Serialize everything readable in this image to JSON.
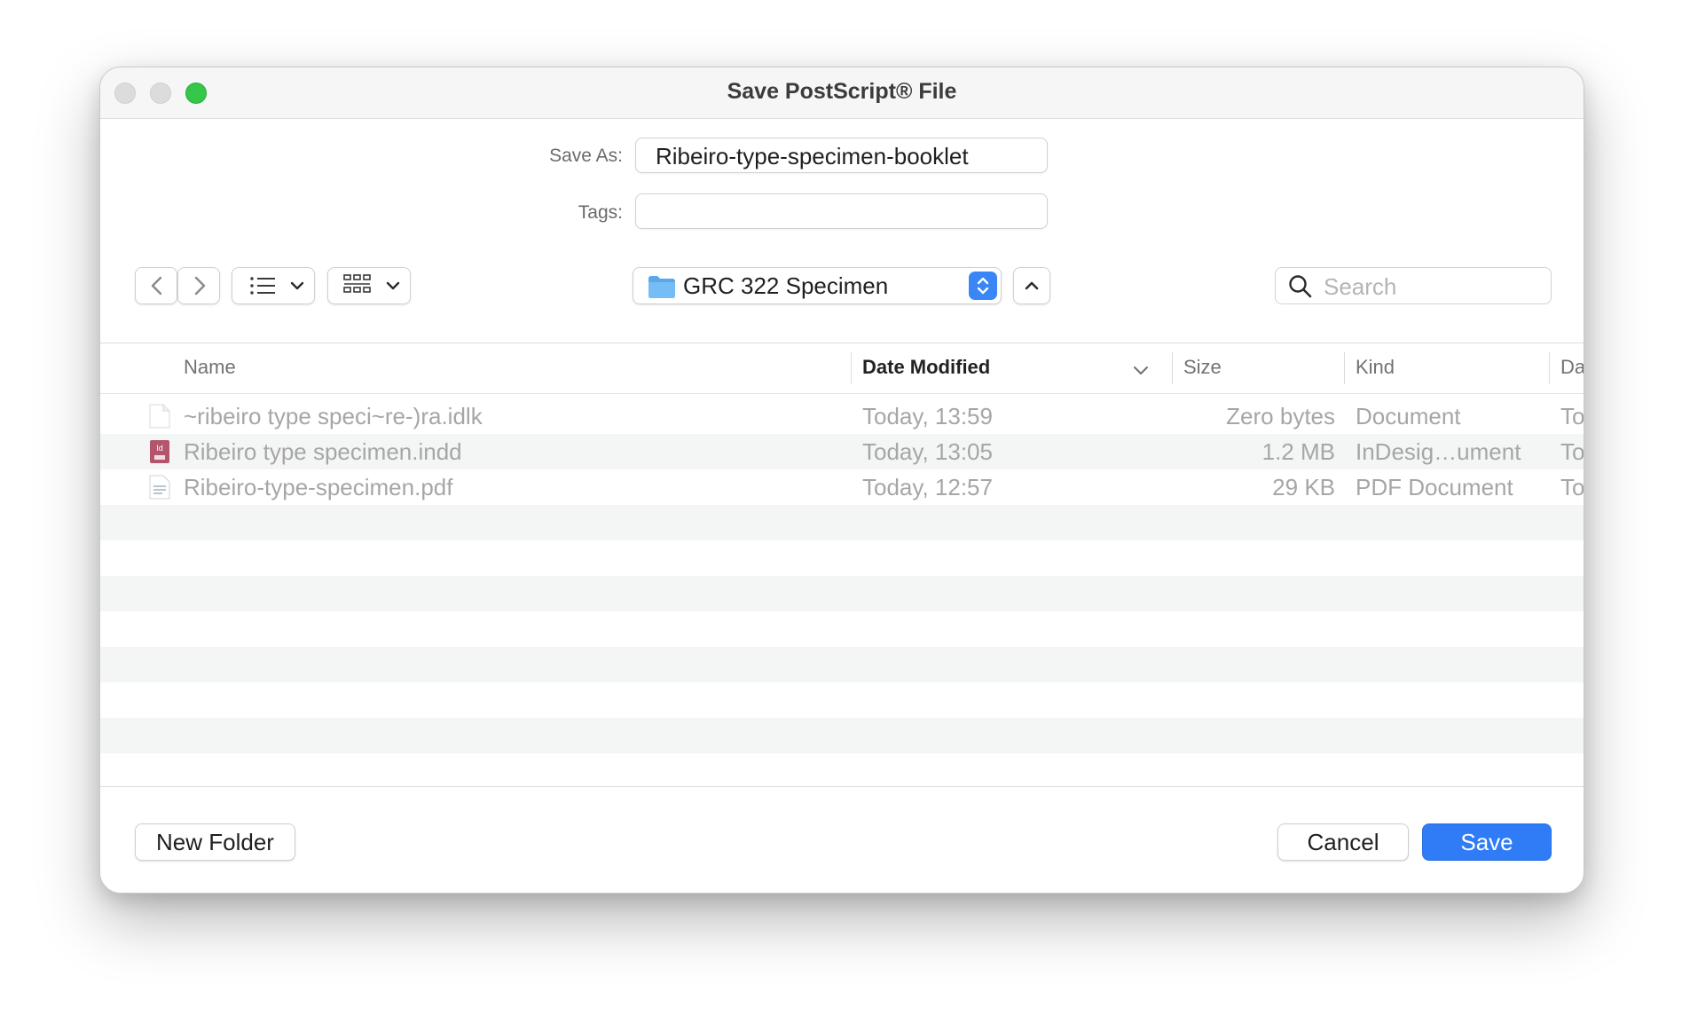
{
  "window": {
    "title": "Save PostScript® File"
  },
  "form": {
    "save_as_label": "Save As:",
    "save_as_value": "Ribeiro-type-specimen-booklet",
    "tags_label": "Tags:",
    "tags_value": ""
  },
  "toolbar": {
    "location": "GRC 322 Specimen",
    "search_placeholder": "Search",
    "icons": [
      "chevron-left-icon",
      "chevron-right-icon",
      "list-view-icon",
      "gallery-view-icon",
      "folder-icon",
      "stepper-icon",
      "chevron-up-icon",
      "search-icon"
    ]
  },
  "columns": {
    "name": "Name",
    "date_modified": "Date Modified",
    "size": "Size",
    "kind": "Kind",
    "date_added": "Da"
  },
  "files": [
    {
      "name": "~ribeiro type speci~re-)ra.idlk",
      "date": "Today, 13:59",
      "size": "Zero bytes",
      "kind": "Document",
      "added": "To",
      "icon": "generic-document-icon"
    },
    {
      "name": "Ribeiro type specimen.indd",
      "date": "Today, 13:05",
      "size": "1.2 MB",
      "kind": "InDesig…ument",
      "added": "To",
      "icon": "indesign-document-icon"
    },
    {
      "name": "Ribeiro-type-specimen.pdf",
      "date": "Today, 12:57",
      "size": "29 KB",
      "kind": "PDF Document",
      "added": "To",
      "icon": "pdf-document-icon"
    }
  ],
  "footer": {
    "new_folder": "New Folder",
    "cancel": "Cancel",
    "save": "Save"
  },
  "colors": {
    "accent": "#2f7cf6",
    "zoom_button": "#34c749"
  }
}
